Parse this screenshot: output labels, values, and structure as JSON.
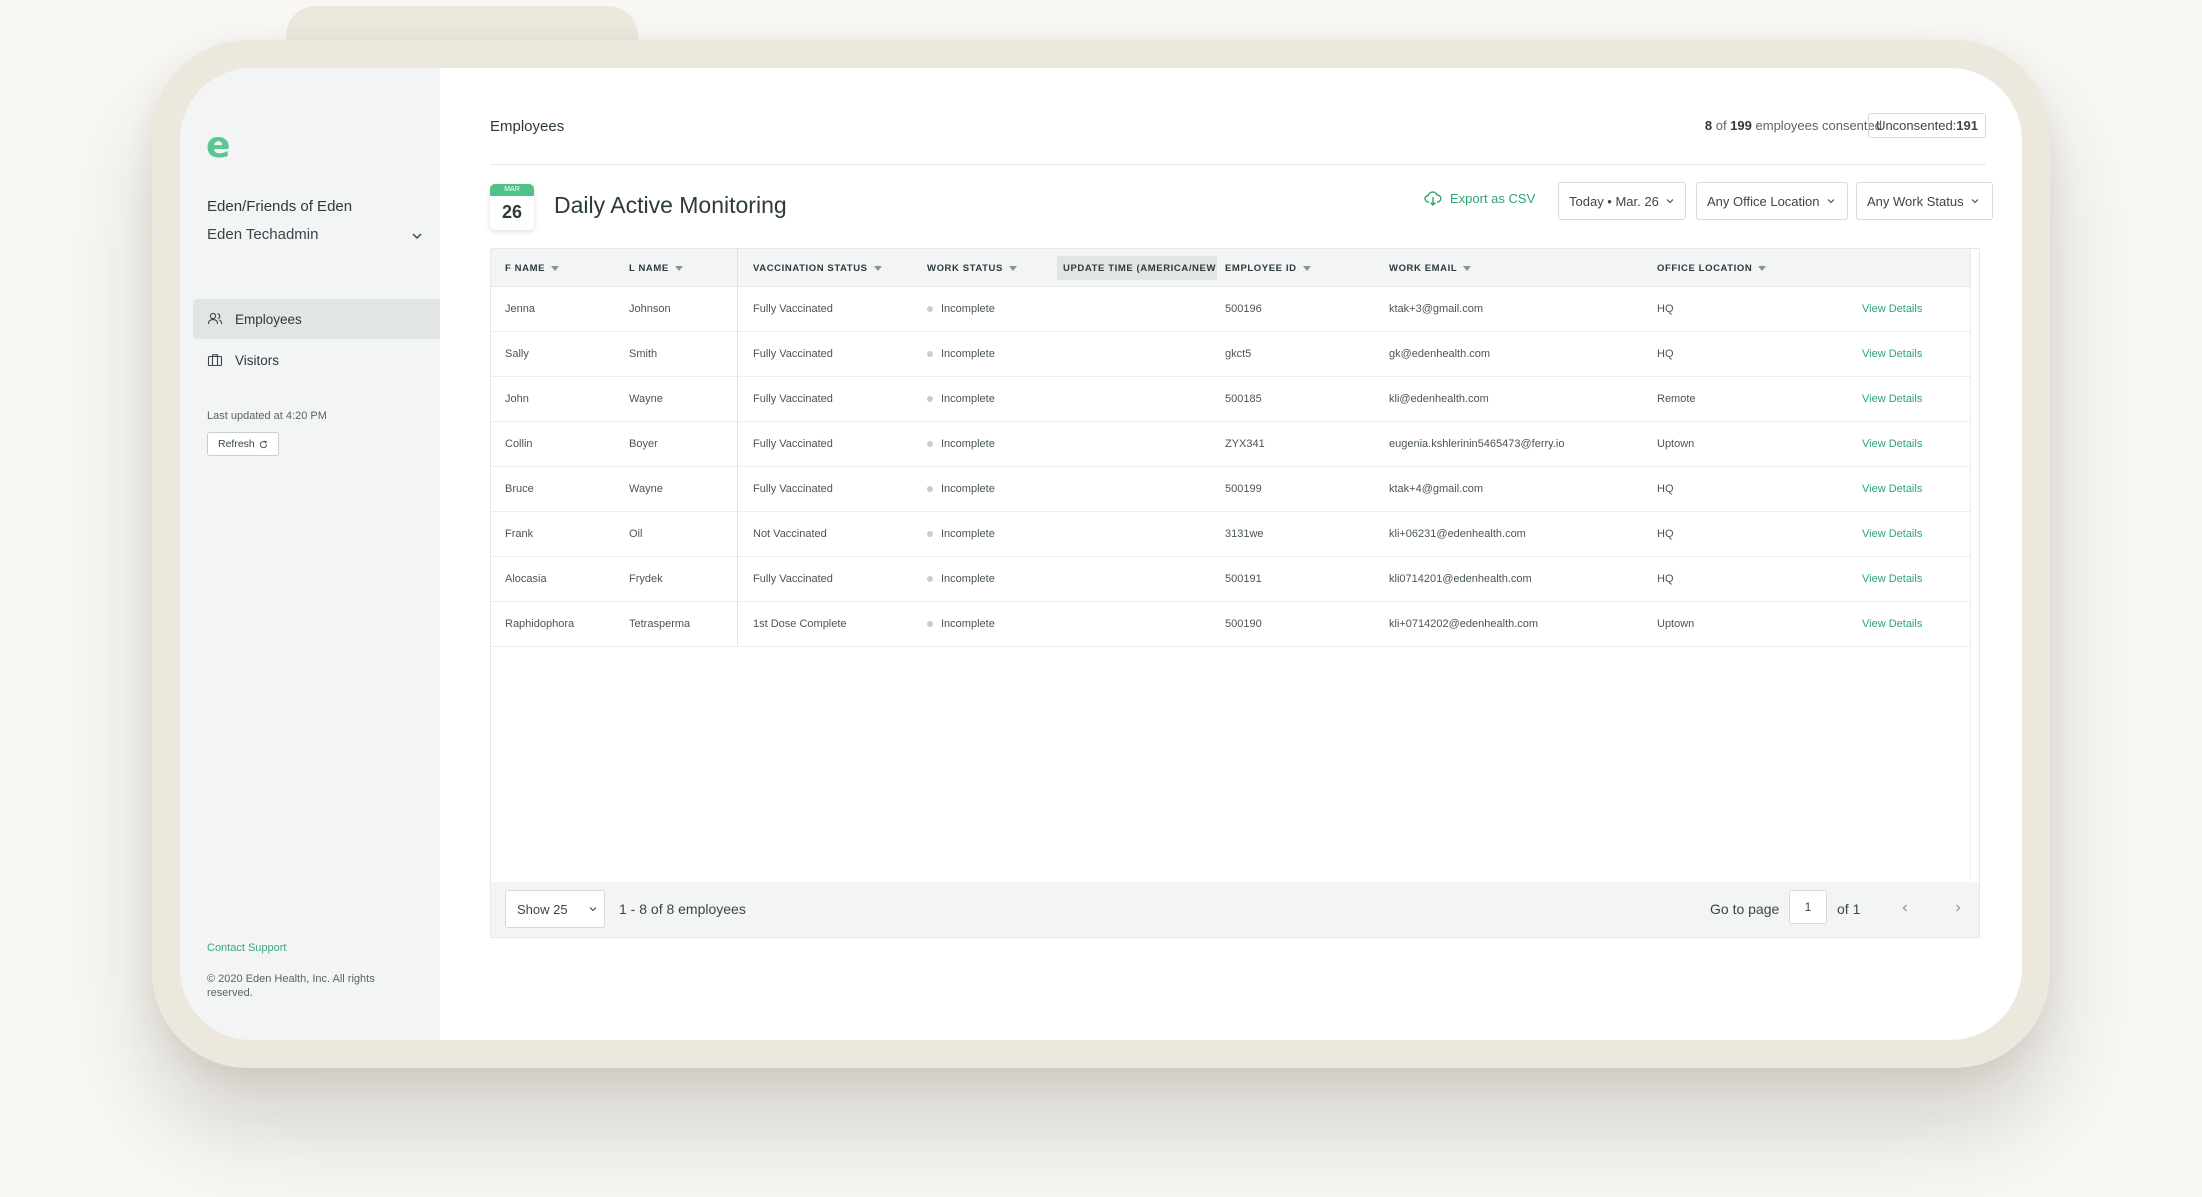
{
  "sidebar": {
    "logo": "e",
    "org": "Eden/Friends of Eden",
    "user": "Eden Techadmin",
    "nav": [
      {
        "label": "Employees",
        "icon": "users-icon",
        "active": true
      },
      {
        "label": "Visitors",
        "icon": "briefcase-icon",
        "active": false
      }
    ],
    "last_updated": "Last updated at 4:20 PM",
    "refresh_label": "Refresh",
    "contact": "Contact Support",
    "copyright": "© 2020 Eden Health, Inc. All rights reserved."
  },
  "header": {
    "title": "Employees",
    "consented_count": "8",
    "consented_of": "of",
    "total_count": "199",
    "consented_suffix": "employees consented",
    "unconsented_label": "Unconsented:",
    "unconsented_value": "191"
  },
  "monitoring": {
    "cal_month": "MAR",
    "cal_day": "26",
    "title": "Daily Active Monitoring",
    "export_label": "Export as CSV",
    "filters": {
      "date": "Today • Mar. 26",
      "location": "Any Office Location",
      "work_status": "Any Work Status"
    }
  },
  "table": {
    "columns": [
      "F Name",
      "L Name",
      "Vaccination Status",
      "Work Status",
      "Update Time (America/New",
      "Employee ID",
      "Work Email",
      "Office Location"
    ],
    "rows": [
      {
        "first": "Jenna",
        "last": "Johnson",
        "vax": "Fully Vaccinated",
        "work": "Incomplete",
        "id": "500196",
        "email": "ktak+3@gmail.com",
        "office": "HQ",
        "action": "View Details"
      },
      {
        "first": "Sally",
        "last": "Smith",
        "vax": "Fully Vaccinated",
        "work": "Incomplete",
        "id": "gkct5",
        "email": "gk@edenhealth.com",
        "office": "HQ",
        "action": "View Details"
      },
      {
        "first": "John",
        "last": "Wayne",
        "vax": "Fully Vaccinated",
        "work": "Incomplete",
        "id": "500185",
        "email": "kli@edenhealth.com",
        "office": "Remote",
        "action": "View Details"
      },
      {
        "first": "Collin",
        "last": "Boyer",
        "vax": "Fully Vaccinated",
        "work": "Incomplete",
        "id": "ZYX341",
        "email": "eugenia.kshlerinin5465473@ferry.io",
        "office": "Uptown",
        "action": "View Details"
      },
      {
        "first": "Bruce",
        "last": "Wayne",
        "vax": "Fully Vaccinated",
        "work": "Incomplete",
        "id": "500199",
        "email": "ktak+4@gmail.com",
        "office": "HQ",
        "action": "View Details"
      },
      {
        "first": "Frank",
        "last": "Oil",
        "vax": "Not Vaccinated",
        "work": "Incomplete",
        "id": "3131we",
        "email": "kli+06231@edenhealth.com",
        "office": "HQ",
        "action": "View Details"
      },
      {
        "first": "Alocasia",
        "last": "Frydek",
        "vax": "Fully Vaccinated",
        "work": "Incomplete",
        "id": "500191",
        "email": "kli0714201@edenhealth.com",
        "office": "HQ",
        "action": "View Details"
      },
      {
        "first": "Raphidophora",
        "last": "Tetrasperma",
        "vax": "1st Dose Complete",
        "work": "Incomplete",
        "id": "500190",
        "email": "kli+0714202@edenhealth.com",
        "office": "Uptown",
        "action": "View Details"
      }
    ]
  },
  "pagination": {
    "show": "Show 25",
    "range": "1 - 8 of 8 employees",
    "goto": "Go to page",
    "page": "1",
    "of": "of 1"
  },
  "colors": {
    "accent": "#2fa471",
    "logo": "#5cc68f",
    "frame": "#ece8de"
  }
}
